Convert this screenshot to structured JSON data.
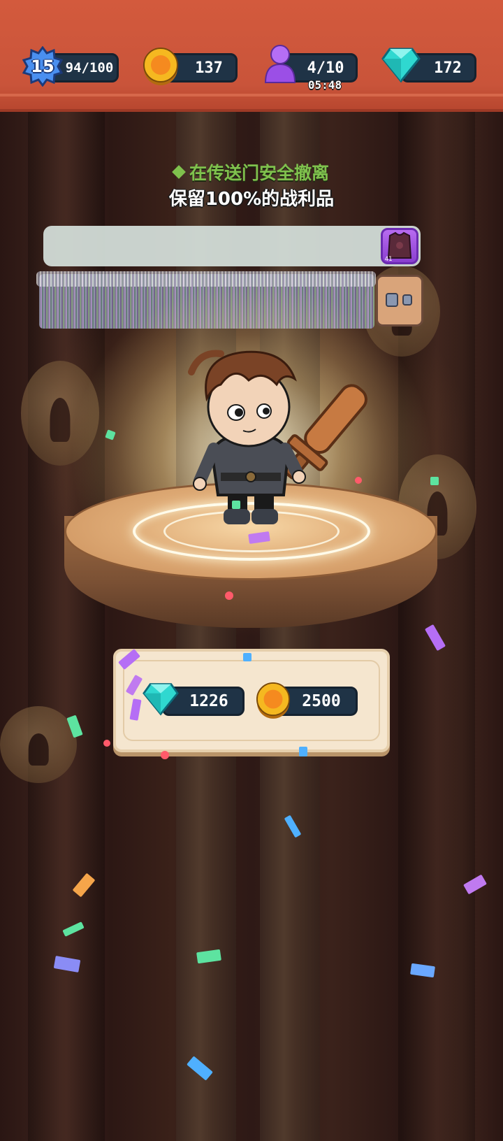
{
  "hud": {
    "level": "15",
    "xp": "94/100",
    "coins": "137",
    "players": "4/10",
    "timer": "05:48",
    "gems": "172"
  },
  "banner": {
    "hint": "在传送门安全撤离",
    "subtitle": "保留100%的战利品"
  },
  "loot": {
    "slot_count": "41"
  },
  "rewards": {
    "gems": "1226",
    "coins": "2500"
  },
  "colors": {
    "hud_bg": "#d35a3d",
    "pill_bg": "#1f3346",
    "hint_green": "#7fc14d",
    "panel_bg": "#f5e6cf",
    "gem": "#2fd8d0",
    "coin": "#f5b820"
  },
  "icons": [
    "level-gear-icon",
    "coin-icon",
    "player-icon",
    "gem-icon",
    "armor-icon",
    "boots-icon"
  ]
}
